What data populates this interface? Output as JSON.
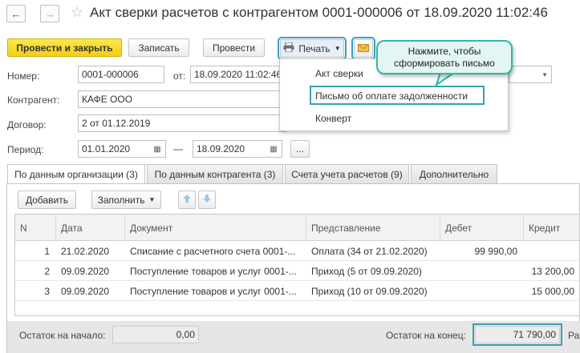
{
  "window": {
    "title": "Акт сверки расчетов с контрагентом 0001-000006 от 18.09.2020 11:02:46",
    "back_icon": "←",
    "forward_icon": "→"
  },
  "toolbar": {
    "post_close_label": "Провести и закрыть",
    "save_label": "Записать",
    "post_label": "Провести",
    "print_label": "Печать"
  },
  "print_menu": {
    "items": [
      "Акт сверки",
      "Письмо об оплате задолженности",
      "Конверт"
    ]
  },
  "tooltip": {
    "text_line1": "Нажмите, чтобы",
    "text_line2": "сформировать письмо"
  },
  "form": {
    "number_label": "Номер:",
    "number_value": "0001-000006",
    "date_label": "от:",
    "date_value": "18.09.2020 11:02:46",
    "contractor_label": "Контрагент:",
    "contractor_value": "КАФЕ ООО",
    "contract_label": "Договор:",
    "contract_value": "2 от 01.12.2019",
    "period_label": "Период:",
    "period_from": "01.01.2020",
    "period_dash": "—",
    "period_to": "18.09.2020",
    "period_more": "..."
  },
  "tabs": [
    {
      "label": "По данным организации (3)"
    },
    {
      "label": "По данным контрагента (3)"
    },
    {
      "label": "Счета учета расчетов (9)"
    },
    {
      "label": "Дополнительно"
    }
  ],
  "table_toolbar": {
    "add_label": "Добавить",
    "fill_label": "Заполнить"
  },
  "table": {
    "columns": [
      "N",
      "Дата",
      "Документ",
      "Представление",
      "Дебет",
      "Кредит"
    ],
    "rows": [
      {
        "n": "1",
        "date": "21.02.2020",
        "doc": "Списание с расчетного счета 0001-...",
        "repr": "Оплата (34 от 21.02.2020)",
        "debit": "99 990,00",
        "credit": ""
      },
      {
        "n": "2",
        "date": "09.09.2020",
        "doc": "Поступление товаров и услуг 0001-...",
        "repr": "Приход (5 от 09.09.2020)",
        "debit": "",
        "credit": "13 200,00"
      },
      {
        "n": "3",
        "date": "09.09.2020",
        "doc": "Поступление товаров и услуг 0001-...",
        "repr": "Приход (10 от 09.09.2020)",
        "debit": "",
        "credit": "15 000,00"
      }
    ]
  },
  "footer": {
    "start_label": "Остаток на начало:",
    "start_value": "0,00",
    "end_label": "Остаток на конец:",
    "end_value": "71 790,00",
    "extra_label": "Ра"
  },
  "colors": {
    "primary_button": "#f2cf16",
    "highlight": "#39a0b6",
    "tooltip_bg": "#e3f6f3",
    "tooltip_border": "#2fb8a8",
    "arrow_blue": "#9cc7ea"
  }
}
